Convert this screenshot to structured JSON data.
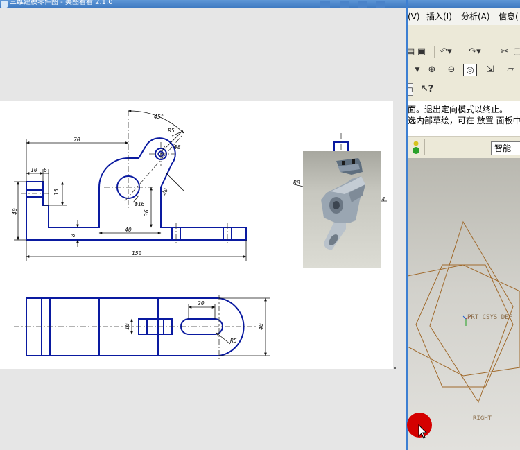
{
  "left_window": {
    "title": "三维建模零件图 - 美图看看 2.1.0",
    "accent": "#3c77c0"
  },
  "drawing": {
    "front_view": {
      "dim_overall_width": "150",
      "dim_boss_offset": "70",
      "dim_left_10": "10",
      "dim_left_6": "6",
      "dim_15": "15",
      "dim_40_height": "40",
      "dim_8": "8",
      "dim_40_center": "40",
      "dim_36": "36",
      "dim_30": "30",
      "dim_phi16": "Φ16",
      "dim_r5": "R5",
      "dim_phi8": "Φ8",
      "dim_angle": "45°"
    },
    "side_view": {
      "dim_r8": "R8",
      "dim_holes": "2XΦ4"
    },
    "top_view": {
      "dim_20": "20",
      "dim_10": "10",
      "dim_40": "40",
      "dim_r5": "R5"
    },
    "line_color": "#0a1aa0",
    "dim_color": "#111111"
  },
  "right_window": {
    "menu": [
      "(V)",
      "插入(I)",
      "分析(A)",
      "信息("
    ],
    "messages": [
      "面。退出定向模式以终止。",
      "选内部草绘，可在 放置 面板中"
    ],
    "filter_label": "智能",
    "csys_label": "PRT_CSYS_DEF",
    "plane_label": "RIGHT",
    "datum_color": "#a06a2c"
  },
  "toolbar_icons": [
    "open-icon",
    "save-icon",
    "undo-icon",
    "redo-icon",
    "cut-icon",
    "zoom-in-icon",
    "zoom-out-icon",
    "refit-icon",
    "orient-icon",
    "display-icon",
    "help-icon"
  ]
}
